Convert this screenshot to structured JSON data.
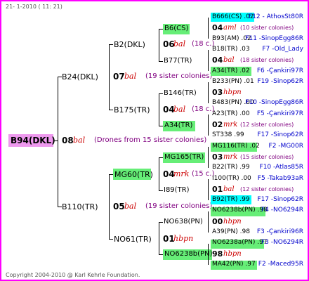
{
  "header": {
    "date": "21-  1-2010 ( 11: 21)",
    "footer": "Copyright 2004-2010 @ Karl Kehrle Foundation."
  },
  "colors": {
    "frame": "#ff00ff",
    "green": "#66ee77",
    "cyan": "#00ffff",
    "pink": "#ee99ee"
  },
  "root": {
    "code": "B94(DKL)",
    "year": "08",
    "bal": "bal",
    "note": "(Drones from 15 sister colonies)"
  },
  "g1": {
    "top": {
      "code": "B24(DKL)",
      "year": "07",
      "bal": "bal",
      "note": "(19 sister colonies)"
    },
    "bottom": {
      "code": "B110(TR)",
      "year": "05",
      "bal": "bal",
      "note": "(19 sister colonies)"
    }
  },
  "g2": {
    "a": {
      "code": "B2(DKL)",
      "year": "06",
      "bal": "bal",
      "note": "(18 c.)"
    },
    "b": {
      "code": "B175(TR)",
      "year": "04",
      "bal": "bal",
      "note": "(18 c.)"
    },
    "c": {
      "code": "MG60(TR)",
      "year": "04",
      "bal": "mrk",
      "note": "(15 c.)"
    },
    "d": {
      "code": "NO61(TR)",
      "year": "01",
      "bal": "hbpn"
    }
  },
  "g3": [
    {
      "code": "B6(CS)"
    },
    {
      "code": "B77(TR)"
    },
    {
      "code": "B146(TR)"
    },
    {
      "code": "A34(TR)"
    },
    {
      "code": "MG165(TR)"
    },
    {
      "code": "I89(TR)"
    },
    {
      "code": "NO638(PN)"
    },
    {
      "code": "NO6238b(PN)"
    }
  ],
  "g4": [
    {
      "l": "B666(CS) .02",
      "r": "F12 - AthosSt80R"
    },
    {
      "y": "04",
      "b": "aml",
      "n": "(10 sister colonies)"
    },
    {
      "l": "B93(AM) .02",
      "r": "F11 -SinopEgg86R"
    },
    {
      "l": "B18(TR) .03",
      "r": "F7 -Old_Lady"
    },
    {
      "y": "04",
      "b": "bal",
      "n": "(18 sister colonies)"
    },
    {
      "l": "A34(TR) .02",
      "r": "F6 -Çankiri97R"
    },
    {
      "l": "B233(PN) .01",
      "r": "F19 -Sinop62R"
    },
    {
      "y": "03",
      "b": "hbpn",
      "n": ""
    },
    {
      "l": "B483(PN) .00",
      "r": "F10 -SinopEgg86R"
    },
    {
      "l": "A23(TR) .00",
      "r": "F5 -Çankiri97R"
    },
    {
      "y": "02",
      "b": "mrk",
      "n": "(12 sister colonies)"
    },
    {
      "l": "ST338 .99",
      "r": "F17 -Sinop62R"
    },
    {
      "l": "MG116(TR) .02",
      "r": "F2 -MG00R"
    },
    {
      "y": "03",
      "b": "mrk",
      "n": "(15 sister colonies)"
    },
    {
      "l": "B22(TR) .99",
      "r": "F10 -Atlas85R"
    },
    {
      "l": "I100(TR) .00",
      "r": "F5 -Takab93aR"
    },
    {
      "y": "01",
      "b": "bal",
      "n": "(12 sister colonies)"
    },
    {
      "l": "B92(TR) .99",
      "r": "F17 -Sinop62R"
    },
    {
      "l": "NO6238b(PN) .98",
      "r": "F4 -NO6294R"
    },
    {
      "y": "00",
      "b": "hbpn",
      "n": ""
    },
    {
      "l": "A39(PN) .98",
      "r": "F3 -Çankiri96R"
    },
    {
      "l": "NO6238a(PN) .97",
      "r": "F3 -NO6294R"
    },
    {
      "y": "98",
      "b": "hbpn",
      "n": ""
    },
    {
      "l": "MA42(PN) .97",
      "r": "F2 -Maced95R"
    }
  ]
}
